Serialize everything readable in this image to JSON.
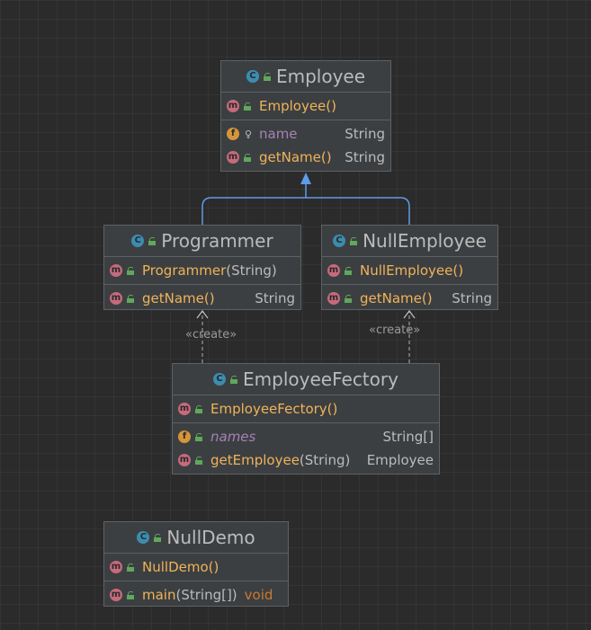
{
  "classes": {
    "employee": {
      "title": "Employee",
      "constructors": [
        {
          "name": "Employee()",
          "type": ""
        }
      ],
      "fields": [
        {
          "name": "name",
          "type": "String"
        }
      ],
      "methods": [
        {
          "name": "getName()",
          "type": "String"
        }
      ]
    },
    "programmer": {
      "title": "Programmer",
      "constructors": [
        {
          "name": "Programmer",
          "params": "(String)",
          "type": ""
        }
      ],
      "methods": [
        {
          "name": "getName()",
          "type": "String"
        }
      ]
    },
    "null_employee": {
      "title": "NullEmployee",
      "constructors": [
        {
          "name": "NullEmployee()",
          "type": ""
        }
      ],
      "methods": [
        {
          "name": "getName()",
          "type": "String"
        }
      ]
    },
    "employee_fectory": {
      "title": "EmployeeFectory",
      "constructors": [
        {
          "name": "EmployeeFectory()",
          "type": ""
        }
      ],
      "fields": [
        {
          "name": "names",
          "type": "String[]"
        }
      ],
      "methods": [
        {
          "name": "getEmployee",
          "params": "(String)",
          "type": "Employee"
        }
      ]
    },
    "null_demo": {
      "title": "NullDemo",
      "constructors": [
        {
          "name": "NullDemo()",
          "type": ""
        }
      ],
      "methods": [
        {
          "name": "main",
          "params": "(String[])",
          "type": "void"
        }
      ]
    }
  },
  "relations": {
    "create_label": "«create»"
  },
  "colors": {
    "inheritance": "#5f9be6",
    "dependency": "#9a9a9a"
  },
  "icons": {
    "class_badge": "class-icon",
    "method_badge": "method-icon",
    "field_badge": "field-icon",
    "public_lock": "public-lock-icon"
  }
}
